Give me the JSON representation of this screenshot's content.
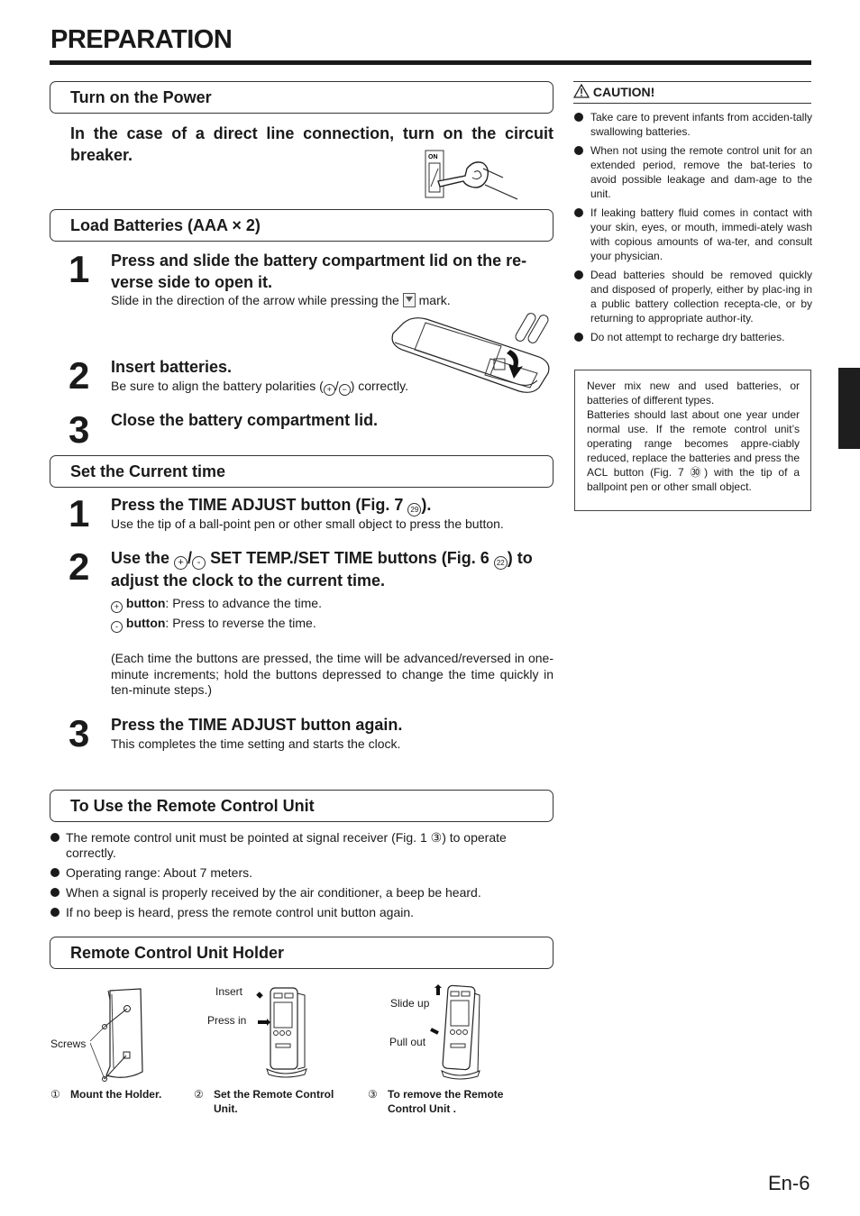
{
  "page": {
    "title": "PREPARATION",
    "page_number": "En-6"
  },
  "turn_on_power": {
    "heading": "Turn on the Power",
    "instruction": "In the case of a direct line connection, turn on the circuit breaker.",
    "switch_label": "ON"
  },
  "load_batteries": {
    "heading": "Load Batteries (AAA × 2)",
    "steps": [
      {
        "number": "1",
        "title": "Press and slide the battery compartment lid on the re-verse side to open it.",
        "detail_before": "Slide in the direction of the arrow while pressing the",
        "detail_after": "mark."
      },
      {
        "number": "2",
        "title": "Insert batteries.",
        "detail_before": "Be sure to align the battery polarities (",
        "polarity_plus": "+",
        "polarity_minus": "−",
        "detail_after": ") correctly."
      },
      {
        "number": "3",
        "title": "Close the battery compartment lid."
      }
    ]
  },
  "set_time": {
    "heading": "Set the Current time",
    "steps": [
      {
        "number": "1",
        "title_before": "Press the TIME ADJUST button (Fig. 7 ",
        "ref": "29",
        "title_after": ").",
        "detail": "Use the tip of a ball-point pen or other small object to press the button."
      },
      {
        "number": "2",
        "title_before": "Use the",
        "plus": "+",
        "minus": "-",
        "title_mid": "SET TEMP./SET TIME buttons (Fig. 6 ",
        "ref": "22",
        "title_after": ") to adjust the clock to the current time.",
        "plus_label": "button",
        "plus_text": ": Press to advance the time.",
        "minus_label": "button",
        "minus_text": ": Press to reverse the time.",
        "note": "(Each time the buttons are pressed, the time will be advanced/reversed in one-minute increments; hold the buttons depressed to change the time quickly in ten-minute steps.)"
      },
      {
        "number": "3",
        "title": "Press the TIME ADJUST button again.",
        "detail": "This completes the time setting and starts the clock."
      }
    ]
  },
  "use_remote": {
    "heading": "To Use the Remote Control Unit",
    "bullets": [
      "The remote control unit must be pointed at signal receiver (Fig. 1 ③) to operate correctly.",
      "Operating range: About 7 meters.",
      "When a signal is properly received by the air conditioner, a beep be heard.",
      "If no beep is heard, press the remote control unit button again."
    ]
  },
  "holder": {
    "heading": "Remote Control Unit Holder",
    "figures": [
      {
        "num": "①",
        "caption": "Mount the Holder.",
        "labels": [
          "Screws"
        ]
      },
      {
        "num": "②",
        "caption": "Set the Remote Control Unit.",
        "labels": [
          "Insert",
          "Press in"
        ]
      },
      {
        "num": "③",
        "caption": "To remove the Remote Control Unit .",
        "labels": [
          "Slide up",
          "Pull out"
        ]
      }
    ]
  },
  "caution": {
    "title": "CAUTION!",
    "bullets": [
      "Take care to prevent infants from acciden-tally swallowing batteries.",
      "When not using the remote control unit for an extended period, remove the bat-teries to avoid possible leakage and dam-age to the unit.",
      "If leaking battery fluid comes in contact with your skin, eyes, or mouth, immedi-ately wash with copious amounts of wa-ter, and consult your physician.",
      "Dead batteries should be removed quickly and disposed of properly, either by plac-ing in a public battery collection recepta-cle, or by returning to appropriate author-ity.",
      "Do not attempt to recharge dry batteries."
    ]
  },
  "battery_note": {
    "line1": "Never mix new and used batteries, or batteries of different types.",
    "line2": "Batteries should last about one year under normal use. If the remote control unit’s operating range becomes appre-ciably reduced, replace the batteries and press the ACL button  (Fig. 7 ㉚) with the tip of a ballpoint pen or other small object."
  }
}
